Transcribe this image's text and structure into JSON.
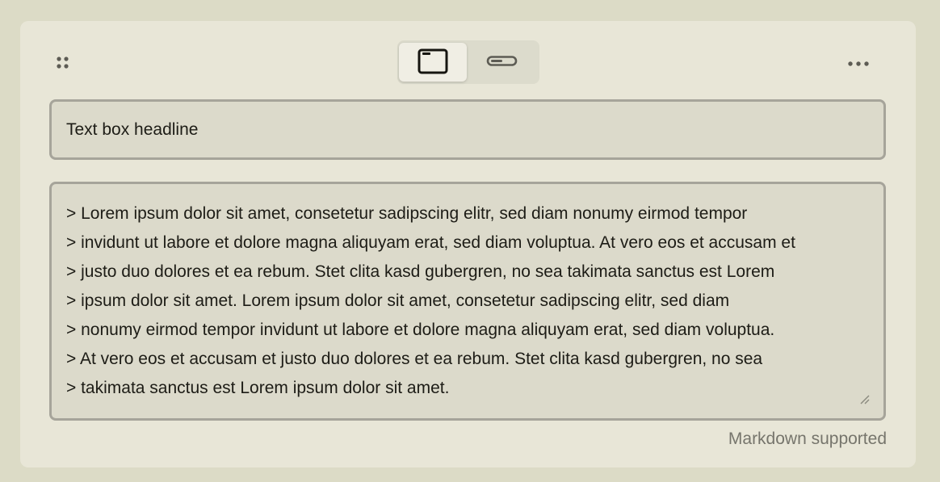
{
  "toolbar": {
    "drag_icon": "drag-handle-icon",
    "view_modes": [
      {
        "name": "card",
        "icon": "window-icon",
        "active": true
      },
      {
        "name": "inline",
        "icon": "pill-icon",
        "active": false
      }
    ],
    "more_icon": "more-options-icon"
  },
  "headline": {
    "value": "Text box headline"
  },
  "body": {
    "lines": [
      "> Lorem ipsum dolor sit amet, consetetur sadipscing elitr, sed diam nonumy eirmod tempor",
      "> invidunt ut labore et dolore magna aliquyam erat, sed diam voluptua. At vero eos et accusam et",
      "> justo duo dolores et ea rebum. Stet clita kasd gubergren, no sea takimata sanctus est Lorem",
      "> ipsum dolor sit amet. Lorem ipsum dolor sit amet, consetetur sadipscing elitr, sed diam",
      "> nonumy eirmod tempor invidunt ut labore et dolore magna aliquyam erat, sed diam voluptua.",
      "> At vero eos et accusam et justo duo dolores et ea rebum. Stet clita kasd gubergren, no sea",
      "> takimata sanctus est Lorem ipsum dolor sit amet."
    ]
  },
  "footer": {
    "note": "Markdown supported"
  },
  "colors": {
    "page_bg": "#dcdbc6",
    "card_bg": "#e8e6d7",
    "field_bg": "#dcdacb",
    "field_border": "#a6a49a",
    "text": "#1d1c16",
    "muted_text": "#76756c"
  }
}
